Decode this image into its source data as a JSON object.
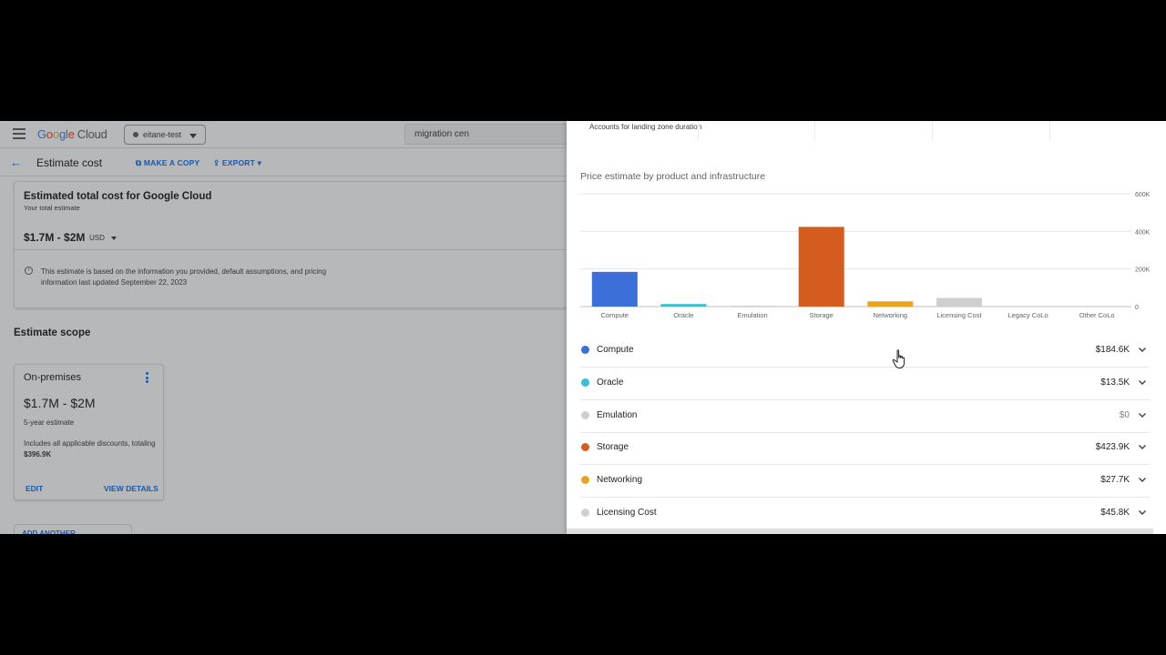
{
  "console": {
    "logo": [
      "G",
      "o",
      "o",
      "g",
      "l",
      "e"
    ],
    "logo_cloud": "Cloud",
    "project": "eitane-test",
    "search_value": "migration cen",
    "page_title": "Estimate cost",
    "make_copy": "MAKE A COPY",
    "export": "EXPORT"
  },
  "estimate": {
    "heading": "Estimated total cost for Google Cloud",
    "subheading": "Your total estimate",
    "amount": "$1.7M - $2M",
    "currency": "USD",
    "note": "This estimate is based on the information you provided, default assumptions, and pricing information last updated September 22, 2023"
  },
  "scope": {
    "title": "Estimate scope",
    "card_title": "On-premises",
    "card_amount": "$1.7M - $2M",
    "card_years": "5-year estimate",
    "card_discount_prefix": "Includes all applicable discounts, totaling ",
    "card_discount_value": "$396.9K",
    "edit": "EDIT",
    "view": "VIEW DETAILS",
    "add_env": "ADD ANOTHER ENVIRONMENT"
  },
  "panel": {
    "landing_note": "Accounts for landing zone duration",
    "chart_title": "Price estimate by product and infrastructure"
  },
  "chart_data": {
    "type": "bar",
    "title": "Price estimate by product and infrastructure",
    "categories": [
      "Compute",
      "Oracle",
      "Emulation",
      "Storage",
      "Networking",
      "Licensing Cost",
      "Legacy CoLo",
      "Other CoLo"
    ],
    "values": [
      184600,
      13500,
      0,
      423900,
      27700,
      45800,
      0,
      0
    ],
    "colors": [
      "#3d6fd9",
      "#3bbfcf",
      "#cfcfcf",
      "#d45c1e",
      "#eaa31e",
      "#cfcfcf",
      "#cfcfcf",
      "#cfcfcf"
    ],
    "y_ticks": [
      "0",
      "200K",
      "400K",
      "600K"
    ],
    "ylim": [
      0,
      600000
    ],
    "grid": true
  },
  "breakdown": [
    {
      "label": "Compute",
      "value": "$184.6K",
      "color": "#3d6fd9"
    },
    {
      "label": "Oracle",
      "value": "$13.5K",
      "color": "#3bbfcf"
    },
    {
      "label": "Emulation",
      "value": "$0",
      "color": "#cfcfcf",
      "muted": true
    },
    {
      "label": "Storage",
      "value": "$423.9K",
      "color": "#d45c1e"
    },
    {
      "label": "Networking",
      "value": "$27.7K",
      "color": "#eaa31e"
    },
    {
      "label": "Licensing Cost",
      "value": "$45.8K",
      "color": "#cfcfcf"
    }
  ]
}
